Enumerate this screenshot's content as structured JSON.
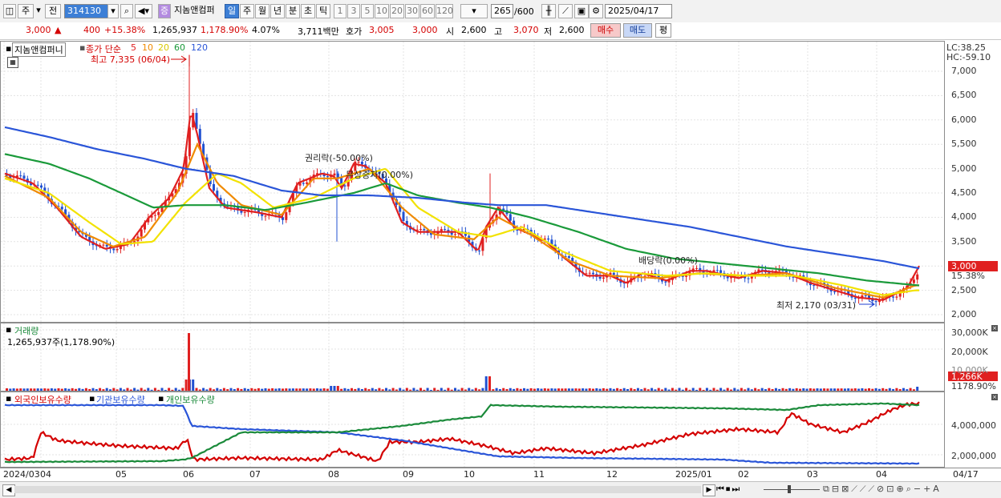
{
  "toolbar": {
    "market_mode": "주",
    "prev_label": "전",
    "code": "314130",
    "badge": "증",
    "stock_name": "지놈앤컴퍼",
    "periods": [
      "일",
      "주",
      "월",
      "년",
      "분",
      "초",
      "틱"
    ],
    "intervals": [
      "1",
      "3",
      "5",
      "10",
      "20",
      "30",
      "60",
      "120"
    ],
    "count_value": "265",
    "count_total": "/600",
    "date": "2025/04/17"
  },
  "quote": {
    "price": "3,000",
    "change": "400",
    "change_pct": "+15.38%",
    "volume": "1,265,937",
    "volume_pct": "1,178.90%",
    "turnover": "4.07%",
    "amount": "3,711백만",
    "ask_label": "호가",
    "ask": "3,005",
    "bid": "3,000",
    "open_label": "시",
    "open": "2,600",
    "high_label": "고",
    "high": "3,070",
    "low_label": "저",
    "low": "2,600",
    "buy_label": "매수",
    "sell_label": "매도",
    "eval_label": "평"
  },
  "price_panel": {
    "stock_name": "지놈앤컴퍼니",
    "legend_prefix": "종가 단순",
    "ma_periods": [
      "5",
      "10",
      "20",
      "60",
      "120"
    ],
    "ma_colors": [
      "#e02020",
      "#f08a00",
      "#f2e200",
      "#1a9a3a",
      "#2a55d8"
    ],
    "max_annotation": "최고 7,335 (06/04)",
    "min_annotation": "최저 2,170 (03/31)",
    "event_1": "권리락(-50.00%)",
    "event_2": "무상증자(0.00%)",
    "event_3": "배당락(0.00%)",
    "lc": "LC:38.25",
    "hc": "HC:-59.10",
    "current_price": "3,000",
    "current_pct": "15.38%",
    "y_ticks": [
      "7,000",
      "6,500",
      "6,000",
      "5,500",
      "5,000",
      "4,500",
      "4,000",
      "3,500",
      "3,000",
      "2,500",
      "2,000"
    ]
  },
  "volume_panel": {
    "title": "거래량",
    "info": "1,265,937주(1,178.90%)",
    "y_ticks": [
      "30,000K",
      "20,000K",
      "10,000K"
    ],
    "current": "1,266K",
    "current_pct": "1178.90%"
  },
  "holdings_panel": {
    "series": [
      "외국인보유수량",
      "기관보유수량",
      "개인보유수량"
    ],
    "colors": [
      "#d40000",
      "#2a55d8",
      "#1a8a3a"
    ],
    "y_ticks": [
      "4,000,000",
      "2,000,000"
    ]
  },
  "x_labels": [
    "2024/03",
    "04",
    "05",
    "06",
    "07",
    "08",
    "09",
    "10",
    "11",
    "12",
    "2025/01",
    "02",
    "03",
    "04"
  ],
  "x_right_label": "04/17",
  "chart_data": {
    "type": "line",
    "title": "지놈앤컴퍼니",
    "series": [
      {
        "name": "종가",
        "x": [
          "2024-03",
          "2024-04",
          "2024-05",
          "2024-06",
          "2024-07",
          "2024-08",
          "2024-09",
          "2024-10",
          "2024-11",
          "2024-12",
          "2025-01",
          "2025-02",
          "2025-03",
          "2025-04-17"
        ],
        "values": [
          4900,
          3600,
          3500,
          5700,
          4100,
          4900,
          3900,
          3800,
          3500,
          2750,
          2800,
          2850,
          2350,
          3000
        ]
      }
    ],
    "high": {
      "label": "최고",
      "value": 7335,
      "date": "06/04"
    },
    "low": {
      "label": "최저",
      "value": 2170,
      "date": "03/31"
    },
    "ylim": [
      2000,
      7000
    ]
  }
}
